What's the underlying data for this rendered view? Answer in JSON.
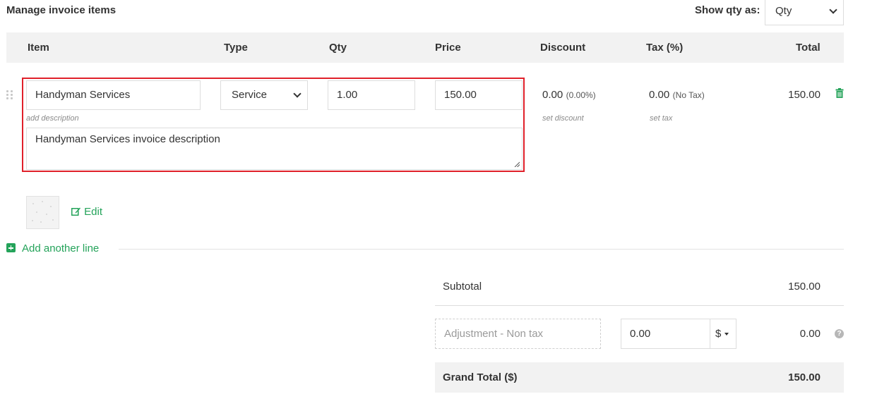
{
  "header": {
    "title": "Manage invoice items",
    "show_qty_label": "Show qty as:",
    "show_qty_value": "Qty"
  },
  "columns": {
    "item": "Item",
    "type": "Type",
    "qty": "Qty",
    "price": "Price",
    "discount": "Discount",
    "tax": "Tax (%)",
    "total": "Total"
  },
  "line_item": {
    "name": "Handyman Services",
    "type": "Service",
    "qty": "1.00",
    "price": "150.00",
    "add_description_label": "add description",
    "description": "Handyman Services invoice description",
    "discount_value": "0.00",
    "discount_percent": "(0.00%)",
    "set_discount_label": "set discount",
    "tax_value": "0.00",
    "tax_name": "(No Tax)",
    "set_tax_label": "set tax",
    "total": "150.00",
    "edit_label": "Edit"
  },
  "add_line_label": "Add another line",
  "summary": {
    "subtotal_label": "Subtotal",
    "subtotal_value": "150.00",
    "adjustment_placeholder": "Adjustment - Non tax",
    "adjustment_amount": "0.00",
    "adjustment_unit": "$",
    "adjustment_total": "0.00",
    "grand_total_label": "Grand Total ($)",
    "grand_total_value": "150.00"
  },
  "colors": {
    "accent_green": "#24a35a",
    "highlight_red": "#e0202a",
    "header_bg": "#f2f2f2"
  },
  "icons": {
    "drag": "drag-handle-icon",
    "delete": "trash-icon",
    "edit": "edit-icon",
    "add": "plus-square-icon",
    "help": "question-circle-icon"
  }
}
